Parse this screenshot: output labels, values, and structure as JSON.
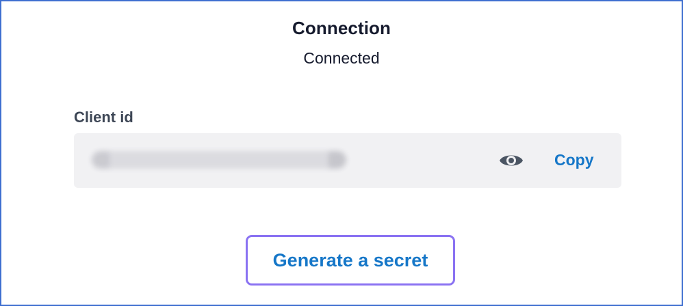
{
  "connection": {
    "title": "Connection",
    "status": "Connected"
  },
  "client_id": {
    "label": "Client id",
    "reveal_icon": "eye-icon",
    "copy_label": "Copy"
  },
  "actions": {
    "generate_secret_label": "Generate a secret"
  },
  "colors": {
    "frame_border": "#3f6fd0",
    "text_primary": "#151a2d",
    "label_text": "#3d4655",
    "link_blue": "#1677c8",
    "focus_outline": "#8a72f2",
    "field_background": "#f1f1f3"
  }
}
